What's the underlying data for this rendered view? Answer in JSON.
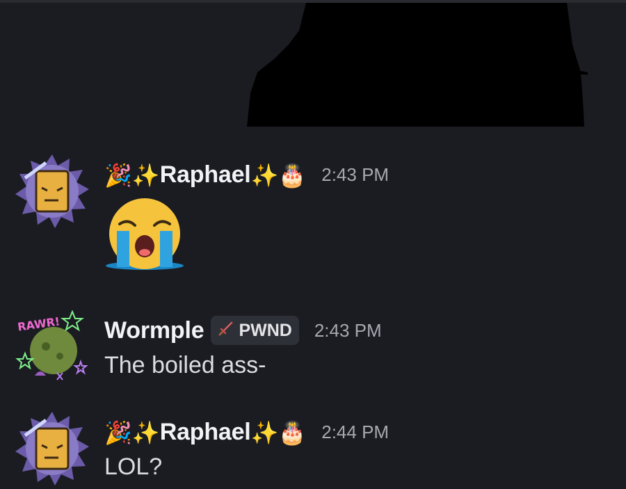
{
  "messages": [
    {
      "username": "Raphael",
      "prefix_emoji": "🎉✨",
      "suffix_emoji": "✨🎂",
      "timestamp": "2:43 PM",
      "content_emoji_name": "loudly-crying-face"
    },
    {
      "username": "Wormple",
      "tag_icon_name": "sword-icon",
      "tag_label": "PWND",
      "timestamp": "2:43 PM",
      "content": "The boiled ass-",
      "avatar_text": "RAWR!"
    },
    {
      "username": "Raphael",
      "prefix_emoji": "🎉✨",
      "suffix_emoji": "✨🎂",
      "timestamp": "2:44 PM",
      "content": "LOL?"
    }
  ],
  "colors": {
    "background": "#1b1c22",
    "username": "#f2f3f5",
    "timestamp": "#a7a9b0",
    "message_text": "#dbdee1",
    "tag_background": "#2e3037"
  }
}
